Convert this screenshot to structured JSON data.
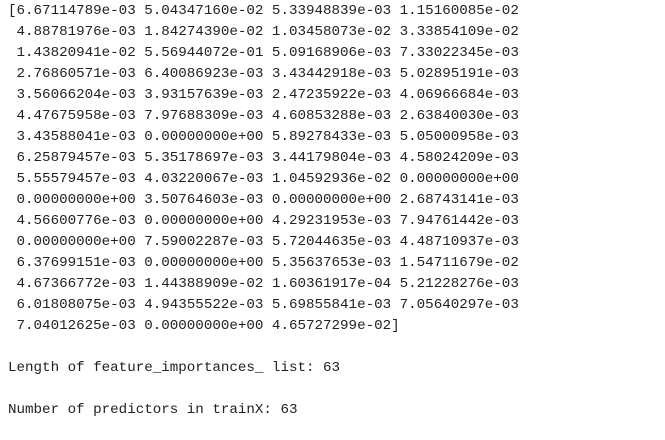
{
  "output": {
    "array_lines": [
      "[6.67114789e-03 5.04347160e-02 5.33948839e-03 1.15160085e-02",
      " 4.88781976e-03 1.84274390e-02 1.03458073e-02 3.33854109e-02",
      " 1.43820941e-02 5.56944072e-01 5.09168906e-03 7.33022345e-03",
      " 2.76860571e-03 6.40086923e-03 3.43442918e-03 5.02895191e-03",
      " 3.56066204e-03 3.93157639e-03 2.47235922e-03 4.06966684e-03",
      " 4.47675958e-03 7.97688309e-03 4.60853288e-03 2.63840030e-03",
      " 3.43588041e-03 0.00000000e+00 5.89278433e-03 5.05000958e-03",
      " 6.25879457e-03 5.35178697e-03 3.44179804e-03 4.58024209e-03",
      " 5.55579457e-03 4.03220067e-03 1.04592936e-02 0.00000000e+00",
      " 0.00000000e+00 3.50764603e-03 0.00000000e+00 2.68743141e-03",
      " 4.56600776e-03 0.00000000e+00 4.29231953e-03 7.94761442e-03",
      " 0.00000000e+00 7.59002287e-03 5.72044635e-03 4.48710937e-03",
      " 6.37699151e-03 0.00000000e+00 5.35637653e-03 1.54711679e-02",
      " 4.67366772e-03 1.44388909e-02 1.60361917e-04 5.21228276e-03",
      " 6.01808075e-03 4.94355522e-03 5.69855841e-03 7.05640297e-03",
      " 7.04012625e-03 0.00000000e+00 4.65727299e-02]"
    ],
    "length_line": "Length of feature_importances_ list: 63",
    "predictors_line": "Number of predictors in trainX: 63"
  }
}
